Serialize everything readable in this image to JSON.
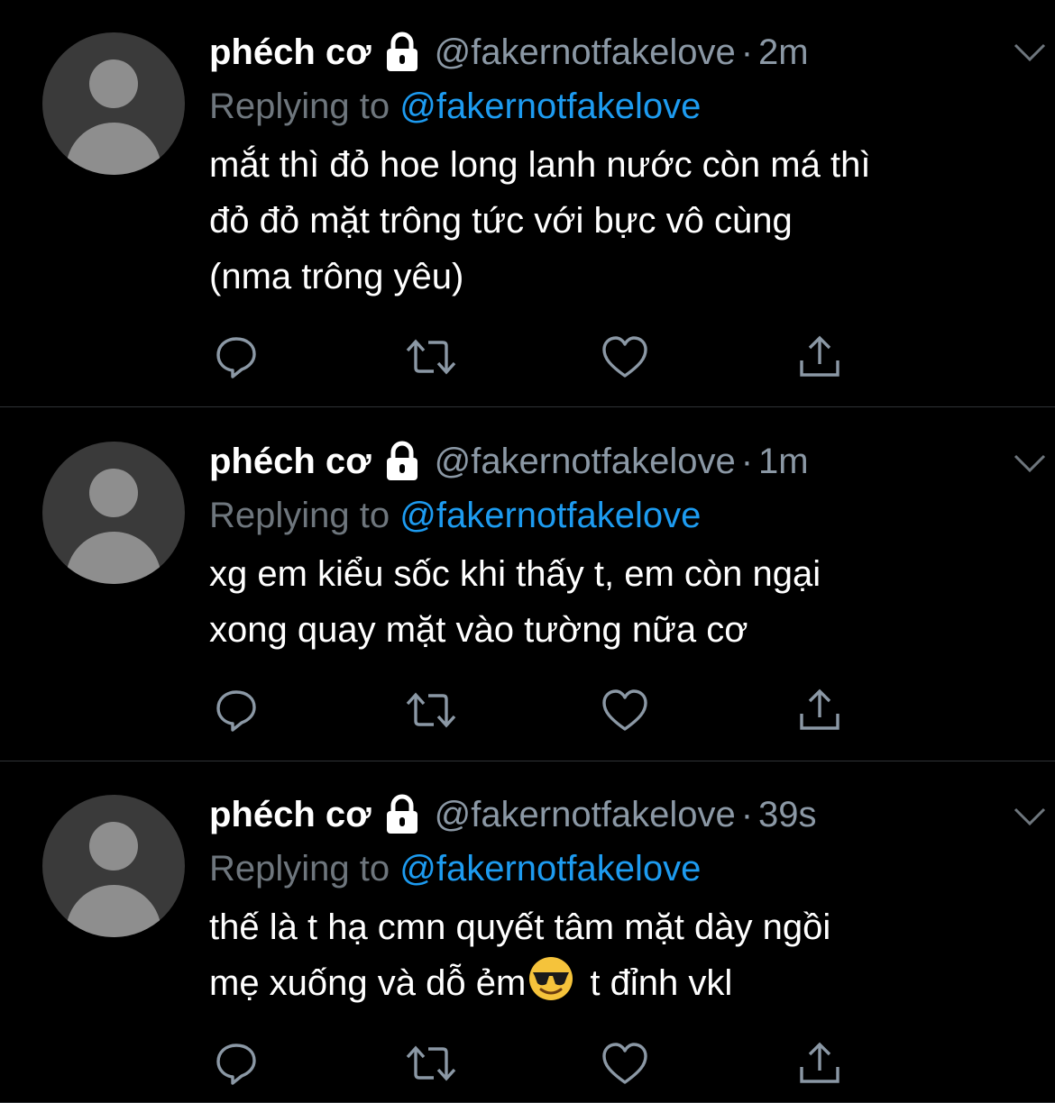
{
  "colors": {
    "background": "#000000",
    "secondary_text": "#8b98a5",
    "mention": "#1d9bf0",
    "divider": "#2f3336"
  },
  "tweets": [
    {
      "name": "phéch cơ",
      "handle": "@fakernotfakelove",
      "separator": "·",
      "time": "2m",
      "replying_label": "Replying to",
      "replying_to": "@fakernotfakelove",
      "lines": [
        "mắt thì đỏ hoe long lanh nước còn má thì",
        "đỏ đỏ mặt trông tức với bực vô cùng",
        "(nma trông yêu)"
      ]
    },
    {
      "name": "phéch cơ",
      "handle": "@fakernotfakelove",
      "separator": "·",
      "time": "1m",
      "replying_label": "Replying to",
      "replying_to": "@fakernotfakelove",
      "lines": [
        "xg em kiểu sốc khi thấy t, em còn ngại",
        "xong quay mặt vào tường nữa cơ"
      ]
    },
    {
      "name": "phéch cơ",
      "handle": "@fakernotfakelove",
      "separator": "·",
      "time": "39s",
      "replying_label": "Replying to",
      "replying_to": "@fakernotfakelove",
      "line1": "thế là t hạ cmn quyết tâm mặt dày ngồi",
      "line2_before": "mẹ xuống và dỗ ẻm",
      "line2_emoji": "smiling-face-with-sunglasses-emoji",
      "line2_after": " t đỉnh vkl"
    }
  ],
  "icons": {
    "lock": "lock-icon",
    "more": "chevron-down-icon",
    "reply": "reply-icon",
    "retweet": "retweet-icon",
    "like": "heart-icon",
    "share": "share-icon"
  }
}
